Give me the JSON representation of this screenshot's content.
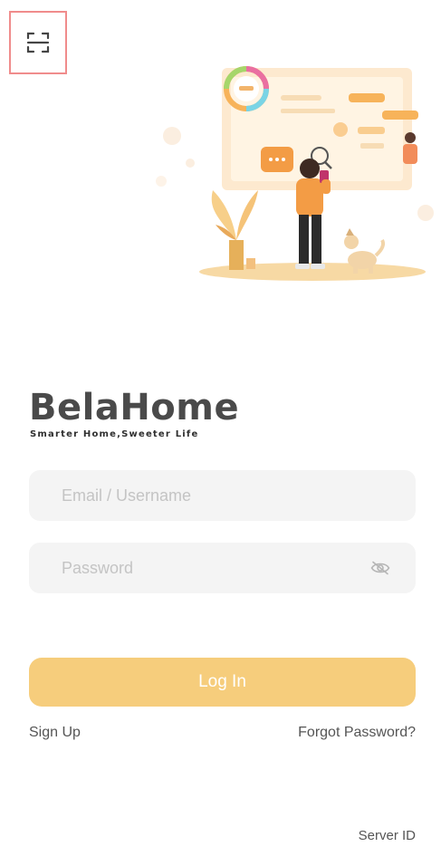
{
  "scan": {
    "icon": "scan-icon"
  },
  "brand": {
    "name": "BelaHome",
    "tagline": "Smarter Home,Sweeter Life"
  },
  "form": {
    "email_placeholder": "Email / Username",
    "password_placeholder": "Password",
    "login_label": "Log In"
  },
  "links": {
    "sign_up": "Sign Up",
    "forgot_password": "Forgot Password?",
    "server_id": "Server ID"
  },
  "colors": {
    "accent": "#f6cd7c",
    "field_bg": "#f4f4f4",
    "scan_border": "#f08c8c"
  }
}
